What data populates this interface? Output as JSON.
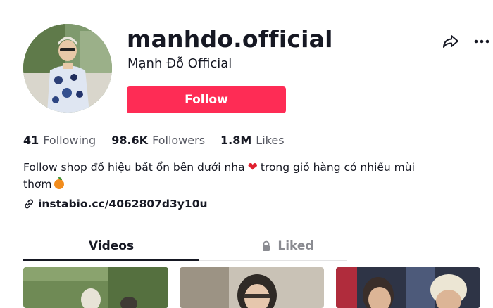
{
  "profile": {
    "username": "manhdo.official",
    "nickname": "Mạnh Đỗ Official",
    "follow_label": "Follow"
  },
  "stats": [
    {
      "value": "41",
      "label": "Following"
    },
    {
      "value": "98.6K",
      "label": "Followers"
    },
    {
      "value": "1.8M",
      "label": "Likes"
    }
  ],
  "bio": {
    "line1_before_heart": "Follow shop đồ hiệu bất ổn bên dưới nha",
    "line1_after_heart": "trong giỏ hàng có nhiều mùi",
    "line2": "thơm"
  },
  "link": {
    "text": "instabio.cc/4062807d3y10u"
  },
  "tabs": [
    {
      "label": "Videos",
      "active": true
    },
    {
      "label": "Liked",
      "locked": true
    }
  ],
  "icons": {
    "share": "share-icon",
    "more": "more-icon",
    "link": "link-icon",
    "lock": "lock-icon",
    "heart": "red-heart-icon",
    "orange": "tangerine-icon"
  },
  "colors": {
    "accent": "#fe2c55",
    "text": "#161823",
    "muted": "#8a8b91",
    "heart": "#e0202f"
  }
}
